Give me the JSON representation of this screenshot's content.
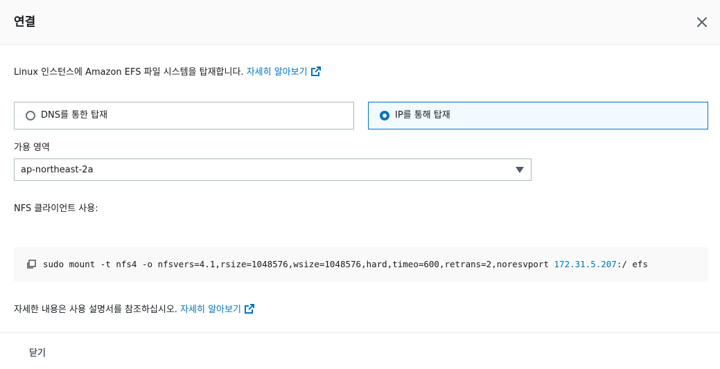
{
  "modal": {
    "title": "연결",
    "close_icon": "close-icon"
  },
  "intro": {
    "text": "Linux 인스턴스에 Amazon EFS 파일 시스템을 탑재합니다. ",
    "link": "자세히 알아보기"
  },
  "mount_options": [
    {
      "label": "DNS를 통한 탑재",
      "selected": false
    },
    {
      "label": "IP를 통해 탑재",
      "selected": true
    }
  ],
  "availability_zone": {
    "label": "가용 영역",
    "value": "ap-northeast-2a"
  },
  "nfs_client": {
    "label": "NFS 클라이언트 사용:",
    "command_prefix": "sudo mount -t nfs4 -o nfsvers=4.1,rsize=1048576,wsize=1048576,hard,timeo=600,retrans=2,noresvport ",
    "ip": "172.31.5.207",
    "command_suffix": ":/ efs"
  },
  "more_info": {
    "text": "자세한 내용은 사용 설명서를 참조하십시오. ",
    "link": "자세히 알아보기"
  },
  "footer": {
    "close_label": "닫기"
  },
  "colors": {
    "accent": "#0073bb",
    "text": "#16191f",
    "border": "#aab7b8",
    "selected_bg": "#f1faff"
  }
}
